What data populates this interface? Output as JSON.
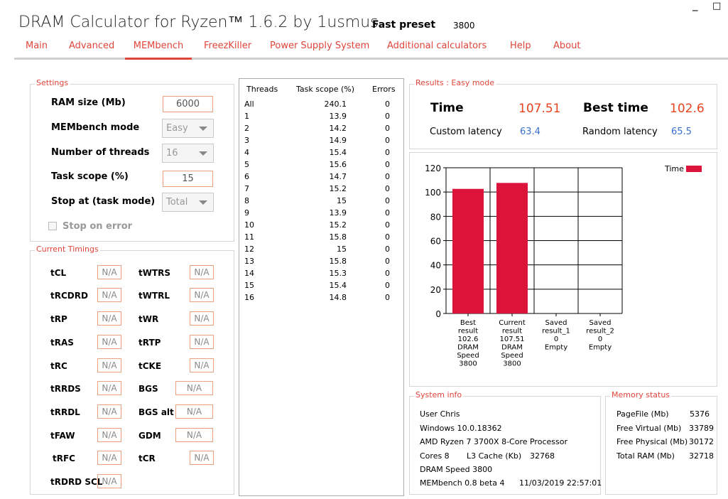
{
  "window": {
    "title": "DRAM Calculator for Ryzen™ 1.6.2 by 1usmus",
    "preset_label": "Fast preset",
    "preset_speed": "3800",
    "minimize": "_",
    "maximize": "□"
  },
  "tabs": [
    "Main",
    "Advanced",
    "MEMbench",
    "FreezKiller",
    "Power Supply System",
    "Additional calculators",
    "Help",
    "About"
  ],
  "active_tab": "MEMbench",
  "settings": {
    "group_label": "Settings",
    "ram_size_label": "RAM size (Mb)",
    "ram_size_value": "6000",
    "mode_label": "MEMbench mode",
    "mode_value": "Easy",
    "threads_label": "Number of threads",
    "threads_value": "16",
    "task_scope_label": "Task scope (%)",
    "task_scope_value": "15",
    "stop_at_label": "Stop at (task mode)",
    "stop_at_value": "Total",
    "stop_on_error_label": "Stop on error"
  },
  "timings": {
    "group_label": "Current Timings",
    "left": [
      {
        "label": "tCL",
        "value": "N/A"
      },
      {
        "label": "tRCDRD",
        "value": "N/A"
      },
      {
        "label": "tRP",
        "value": "N/A"
      },
      {
        "label": "tRAS",
        "value": "N/A"
      },
      {
        "label": "tRC",
        "value": "N/A"
      },
      {
        "label": "tRRDS",
        "value": "N/A"
      },
      {
        "label": "tRRDL",
        "value": "N/A"
      },
      {
        "label": "tFAW",
        "value": "N/A"
      },
      {
        "label": "tRFC",
        "value": "N/A"
      },
      {
        "label": "tRDRD SCL",
        "value": "N/A"
      }
    ],
    "right": [
      {
        "label": "tWTRS",
        "value": "N/A"
      },
      {
        "label": "tWTRL",
        "value": "N/A"
      },
      {
        "label": "tWR",
        "value": "N/A"
      },
      {
        "label": "tRTP",
        "value": "N/A"
      },
      {
        "label": "tCKE",
        "value": "N/A"
      },
      {
        "label": "BGS",
        "value": "N/A"
      },
      {
        "label": "BGS alt",
        "value": "N/A"
      },
      {
        "label": "GDM",
        "value": "N/A"
      },
      {
        "label": "tCR",
        "value": "N/A"
      }
    ]
  },
  "threads_table": {
    "headers": [
      "Threads",
      "Task scope (%)",
      "Errors"
    ],
    "rows": [
      [
        "All",
        "240.1",
        "0"
      ],
      [
        "1",
        "13.9",
        "0"
      ],
      [
        "2",
        "14.2",
        "0"
      ],
      [
        "3",
        "14.9",
        "0"
      ],
      [
        "4",
        "15.4",
        "0"
      ],
      [
        "5",
        "15.6",
        "0"
      ],
      [
        "6",
        "14.7",
        "0"
      ],
      [
        "7",
        "15.2",
        "0"
      ],
      [
        "8",
        "15",
        "0"
      ],
      [
        "9",
        "13.9",
        "0"
      ],
      [
        "10",
        "15.2",
        "0"
      ],
      [
        "11",
        "15.8",
        "0"
      ],
      [
        "12",
        "15",
        "0"
      ],
      [
        "13",
        "15.8",
        "0"
      ],
      [
        "14",
        "15.3",
        "0"
      ],
      [
        "15",
        "15.4",
        "0"
      ],
      [
        "16",
        "14.8",
        "0"
      ]
    ]
  },
  "results": {
    "group_label": "Results : Easy mode",
    "time_label": "Time",
    "time_value": "107.51",
    "best_time_label": "Best time",
    "best_time_value": "102.6",
    "custom_latency_label": "Custom latency",
    "custom_latency_value": "63.4",
    "random_latency_label": "Random latency",
    "random_latency_value": "65.5"
  },
  "chart_data": {
    "type": "bar",
    "categories": [
      [
        "Best",
        "result",
        "102.6",
        "DRAM",
        "Speed",
        "3800"
      ],
      [
        "Current",
        "result",
        "107.51",
        "DRAM",
        "Speed",
        "3800"
      ],
      [
        "Saved",
        "result_1",
        "0",
        "Empty"
      ],
      [
        "Saved",
        "result_2",
        "0",
        "Empty"
      ]
    ],
    "series": [
      {
        "name": "Time",
        "values": [
          102.6,
          107.51,
          0,
          0
        ],
        "color": "#dc143c"
      }
    ],
    "ylim": [
      0,
      120
    ],
    "yticks": [
      "0",
      "20",
      "40",
      "60",
      "80",
      "100",
      "120"
    ],
    "grid": true,
    "legend": "top-right"
  },
  "system_info": {
    "group_label": "System info",
    "user": "User Chris",
    "os": "Windows 10.0.18362",
    "cpu": "AMD Ryzen 7 3700X 8-Core Processor",
    "cores": "Cores 8",
    "l3_label": "L3 Cache (Kb)",
    "l3_value": "32768",
    "dram_speed": "DRAM Speed 3800",
    "version": "MEMbench 0.8 beta 4",
    "datetime": "11/03/2019 22:57:01"
  },
  "memory_status": {
    "group_label": "Memory status",
    "rows": [
      {
        "label": "PageFile (Mb)",
        "value": "5376"
      },
      {
        "label": "Free Virtual (Mb)",
        "value": "33789"
      },
      {
        "label": "Free Physical (Mb)",
        "value": "30172"
      },
      {
        "label": "Total RAM (Mb)",
        "value": "32718"
      }
    ]
  }
}
